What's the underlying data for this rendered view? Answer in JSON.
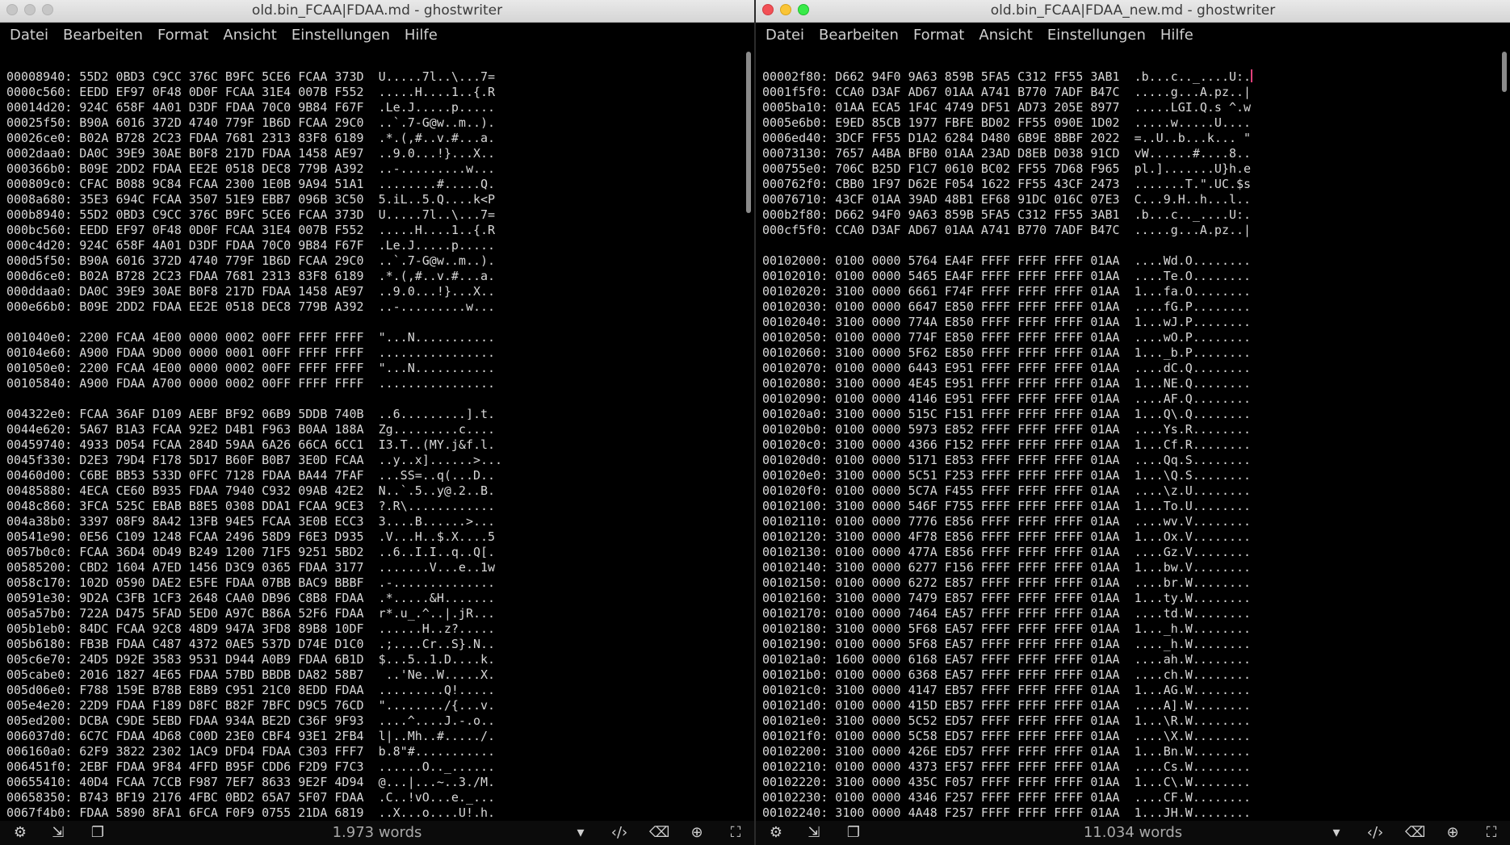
{
  "menu": [
    "Datei",
    "Bearbeiten",
    "Format",
    "Ansicht",
    "Einstellungen",
    "Hilfe"
  ],
  "left": {
    "title": "old.bin_FCAA|FDAA.md - ghostwriter",
    "words": "1.973 words",
    "lines": [
      "00008940: 55D2 0BD3 C9CC 376C B9FC 5CE6 FCAA 373D  U.....7l..\\...7=",
      "0000c560: EEDD EF97 0F48 0D0F FCAA 31E4 007B F552  .....H....1..{.R",
      "00014d20: 924C 658F 4A01 D3DF FDAA 70C0 9B84 F67F  .Le.J.....p.....",
      "00025f50: B90A 6016 372D 4740 779F 1B6D FCAA 29C0  ..`.7-G@w..m..).",
      "00026ce0: B02A B728 2C23 FDAA 7681 2313 83F8 6189  .*.(,#..v.#...a.",
      "0002daa0: DA0C 39E9 30AE B0F8 217D FDAA 1458 AE97  ..9.0...!}...X..",
      "000366b0: B09E 2DD2 FDAA EE2E 0518 DEC8 779B A392  ..-.........w...",
      "000809c0: CFAC B088 9C84 FCAA 2300 1E0B 9A94 51A1  ........#.....Q.",
      "0008a680: 35E3 694C FCAA 3507 51E9 EBB7 096B 3C50  5.iL..5.Q....k<P",
      "000b8940: 55D2 0BD3 C9CC 376C B9FC 5CE6 FCAA 373D  U.....7l..\\...7=",
      "000bc560: EEDD EF97 0F48 0D0F FCAA 31E4 007B F552  .....H....1..{.R",
      "000c4d20: 924C 658F 4A01 D3DF FDAA 70C0 9B84 F67F  .Le.J.....p.....",
      "000d5f50: B90A 6016 372D 4740 779F 1B6D FCAA 29C0  ..`.7-G@w..m..).",
      "000d6ce0: B02A B728 2C23 FDAA 7681 2313 83F8 6189  .*.(,#..v.#...a.",
      "000ddaa0: DA0C 39E9 30AE B0F8 217D FDAA 1458 AE97  ..9.0...!}...X..",
      "000e66b0: B09E 2DD2 FDAA EE2E 0518 DEC8 779B A392  ..-.........w...",
      "",
      "001040e0: 2200 FCAA 4E00 0000 0002 00FF FFFF FFFF  \"...N...........",
      "00104e60: A900 FDAA 9D00 0000 0001 00FF FFFF FFFF  ................",
      "001050e0: 2200 FCAA 4E00 0000 0002 00FF FFFF FFFF  \"...N...........",
      "00105840: A900 FDAA A700 0000 0002 00FF FFFF FFFF  ................",
      "",
      "004322e0: FCAA 36AF D109 AEBF BF92 06B9 5DDB 740B  ..6.........].t.",
      "0044e620: 5A67 B1A3 FCAA 92E2 D4B1 F963 B0AA 188A  Zg.........c....",
      "00459740: 4933 D054 FCAA 284D 59AA 6A26 66CA 6CC1  I3.T..(MY.j&f.l.",
      "0045f330: D2E3 79D4 F178 5D17 B60F B0B7 3E0D FCAA  ..y..x]......>...",
      "00460d00: C6BE BB53 533D 0FFC 7128 FDAA BA44 7FAF  ...SS=..q(...D..",
      "00485880: 4ECA CE60 B935 FDAA 7940 C932 09AB 42E2  N..`.5..y@.2..B.",
      "0048c860: 3FCA 525C EBAB B8E5 0308 DDA1 FCAA 9CE3  ?.R\\............",
      "004a38b0: 3397 08F9 8A42 13FB 94E5 FCAA 3E0B ECC3  3....B......>...",
      "00541e90: 0E56 C109 1248 FCAA 2496 58D9 F6E3 D935  .V...H..$.X....5",
      "0057b0c0: FCAA 36D4 0D49 B249 1200 71F5 9251 5BD2  ..6..I.I..q..Q[.",
      "00585200: CBD2 1604 A7ED 1456 D3C9 0365 FDAA 3177  .......V...e..1w",
      "0058c170: 102D 0590 DAE2 E5FE FDAA 07BB BAC9 BBBF  .-..............",
      "00591e30: 9D2A C3FB 1CF3 2648 CAA0 DB96 C8B8 FDAA  .*.....&H.......",
      "005a57b0: 722A D475 5FAD 5ED0 A97C B86A 52F6 FDAA  r*.u_.^..|.jR...",
      "005b1eb0: 84DC FCAA 92C8 48D9 947A 3FD8 89B8 10DF  ......H..z?.....",
      "005b6180: FB3B FDAA C487 4372 0AE5 537D D74E D1C0  .;....Cr..S}.N..",
      "005c6e70: 24D5 D92E 3583 9531 D944 A0B9 FDAA 6B1D  $...5..1.D....k.",
      "005cabe0: 2016 1827 4E65 FDAA 57BD BBDB DA82 58B7   ..'Ne..W.....X.",
      "005d06e0: F788 159E B78B E8B9 C951 21C0 8EDD FDAA  .........Q!.....",
      "005e4e20: 22D9 FDAA F189 D8FC B82F 7BFC D9C5 76CD  \"......../{...v.",
      "005ed200: DCBA C9DE 5EBD FDAA 934A BE2D C36F 9F93  ....^....J.-.o..",
      "006037d0: 6C7C FDAA 4D68 C00D 23E0 CBF4 93E1 2FB4  l|..Mh..#...../.",
      "006160a0: 62F9 3822 2302 1AC9 DFD4 FDAA C303 FFF7  b.8\"#...........",
      "006451f0: 2EBF FDAA 9F84 4FFD B95F CDD6 F2D9 F7C3  ......O.._......",
      "00655410: 40D4 FCAA 7CCB F987 7EF7 8633 9E2F 4D94  @...|...~..3./M.",
      "00658350: B743 BF19 2176 4FBC 0BD2 65A7 5F07 FDAA  .C..!vO...e._...",
      "0067f4b0: FDAA 5890 8FA1 6FCA F0F9 0755 21DA 6819  ..X...o....U!.h."
    ]
  },
  "right": {
    "title": "old.bin_FCAA|FDAA_new.md - ghostwriter",
    "words": "11.034 words",
    "lines": [
      "00002f80: D662 94F0 9A63 859B 5FA5 C312 FF55 3AB1  .b...c.._....U:.",
      "0001f5f0: CCA0 D3AF AD67 01AA A741 B770 7ADF B47C  .....g...A.pz..|",
      "0005ba10: 01AA ECA5 1F4C 4749 DF51 AD73 205E 8977  .....LGI.Q.s ^.w",
      "0005e6b0: E9ED 85CB 1977 FBFE BD02 FF55 090E 1D02  .....w.....U....",
      "0006ed40: 3DCF FF55 D1A2 6284 D480 6B9E 8BBF 2022  =..U..b...k... \"",
      "00073130: 7657 A4BA BFB0 01AA 23AD D8EB D038 91CD  vW......#....8..",
      "000755e0: 706C B25D F1C7 0610 BC02 FF55 7D68 F965  pl.].......U}h.e",
      "000762f0: CBB0 1F97 D62E F054 1622 FF55 43CF 2473  .......T.\".UC.$s",
      "00076710: 43CF 01AA 39AD 48B1 EF68 91DC 016C 07E3  C...9.H..h...l..",
      "000b2f80: D662 94F0 9A63 859B 5FA5 C312 FF55 3AB1  .b...c.._....U:.",
      "000cf5f0: CCA0 D3AF AD67 01AA A741 B770 7ADF B47C  .....g...A.pz..|",
      "",
      "00102000: 0100 0000 5764 EA4F FFFF FFFF FFFF 01AA  ....Wd.O........",
      "00102010: 0100 0000 5465 EA4F FFFF FFFF FFFF 01AA  ....Te.O........",
      "00102020: 3100 0000 6661 F74F FFFF FFFF FFFF 01AA  1...fa.O........",
      "00102030: 0100 0000 6647 E850 FFFF FFFF FFFF 01AA  ....fG.P........",
      "00102040: 3100 0000 774A E850 FFFF FFFF FFFF 01AA  1...wJ.P........",
      "00102050: 0100 0000 774F E850 FFFF FFFF FFFF 01AA  ....wO.P........",
      "00102060: 3100 0000 5F62 E850 FFFF FFFF FFFF 01AA  1..._b.P........",
      "00102070: 0100 0000 6443 E951 FFFF FFFF FFFF 01AA  ....dC.Q........",
      "00102080: 3100 0000 4E45 E951 FFFF FFFF FFFF 01AA  1...NE.Q........",
      "00102090: 0100 0000 4146 E951 FFFF FFFF FFFF 01AA  ....AF.Q........",
      "001020a0: 3100 0000 515C F151 FFFF FFFF FFFF 01AA  1...Q\\.Q........",
      "001020b0: 0100 0000 5973 E852 FFFF FFFF FFFF 01AA  ....Ys.R........",
      "001020c0: 3100 0000 4366 F152 FFFF FFFF FFFF 01AA  1...Cf.R........",
      "001020d0: 0100 0000 5171 E853 FFFF FFFF FFFF 01AA  ....Qq.S........",
      "001020e0: 3100 0000 5C51 F253 FFFF FFFF FFFF 01AA  1...\\Q.S........",
      "001020f0: 0100 0000 5C7A F455 FFFF FFFF FFFF 01AA  ....\\z.U........",
      "00102100: 3100 0000 546F F755 FFFF FFFF FFFF 01AA  1...To.U........",
      "00102110: 0100 0000 7776 E856 FFFF FFFF FFFF 01AA  ....wv.V........",
      "00102120: 3100 0000 4F78 E856 FFFF FFFF FFFF 01AA  1...Ox.V........",
      "00102130: 0100 0000 477A E856 FFFF FFFF FFFF 01AA  ....Gz.V........",
      "00102140: 3100 0000 6277 F156 FFFF FFFF FFFF 01AA  1...bw.V........",
      "00102150: 0100 0000 6272 E857 FFFF FFFF FFFF 01AA  ....br.W........",
      "00102160: 3100 0000 7479 E857 FFFF FFFF FFFF 01AA  1...ty.W........",
      "00102170: 0100 0000 7464 EA57 FFFF FFFF FFFF 01AA  ....td.W........",
      "00102180: 3100 0000 5F68 EA57 FFFF FFFF FFFF 01AA  1..._h.W........",
      "00102190: 0100 0000 5F68 EA57 FFFF FFFF FFFF 01AA  ...._h.W........",
      "001021a0: 1600 0000 6168 EA57 FFFF FFFF FFFF 01AA  ....ah.W........",
      "001021b0: 0100 0000 6368 EA57 FFFF FFFF FFFF 01AA  ....ch.W........",
      "001021c0: 3100 0000 4147 EB57 FFFF FFFF FFFF 01AA  1...AG.W........",
      "001021d0: 0100 0000 415D EB57 FFFF FFFF FFFF 01AA  ....A].W........",
      "001021e0: 3100 0000 5C52 ED57 FFFF FFFF FFFF 01AA  1...\\R.W........",
      "001021f0: 0100 0000 5C58 ED57 FFFF FFFF FFFF 01AA  ....\\X.W........",
      "00102200: 3100 0000 426E ED57 FFFF FFFF FFFF 01AA  1...Bn.W........",
      "00102210: 0100 0000 4373 EF57 FFFF FFFF FFFF 01AA  ....Cs.W........",
      "00102220: 3100 0000 435C F057 FFFF FFFF FFFF 01AA  1...C\\.W........",
      "00102230: 0100 0000 4346 F257 FFFF FFFF FFFF 01AA  ....CF.W........",
      "00102240: 3100 0000 4A48 F257 FFFF FFFF FFFF 01AA  1...JH.W........"
    ]
  },
  "statusbar_icons": [
    "settings-icon",
    "export-icon",
    "copy-icon",
    "chevron-down-icon",
    "code-icon",
    "backspace-icon",
    "crosshair-icon",
    "fullscreen-icon"
  ]
}
